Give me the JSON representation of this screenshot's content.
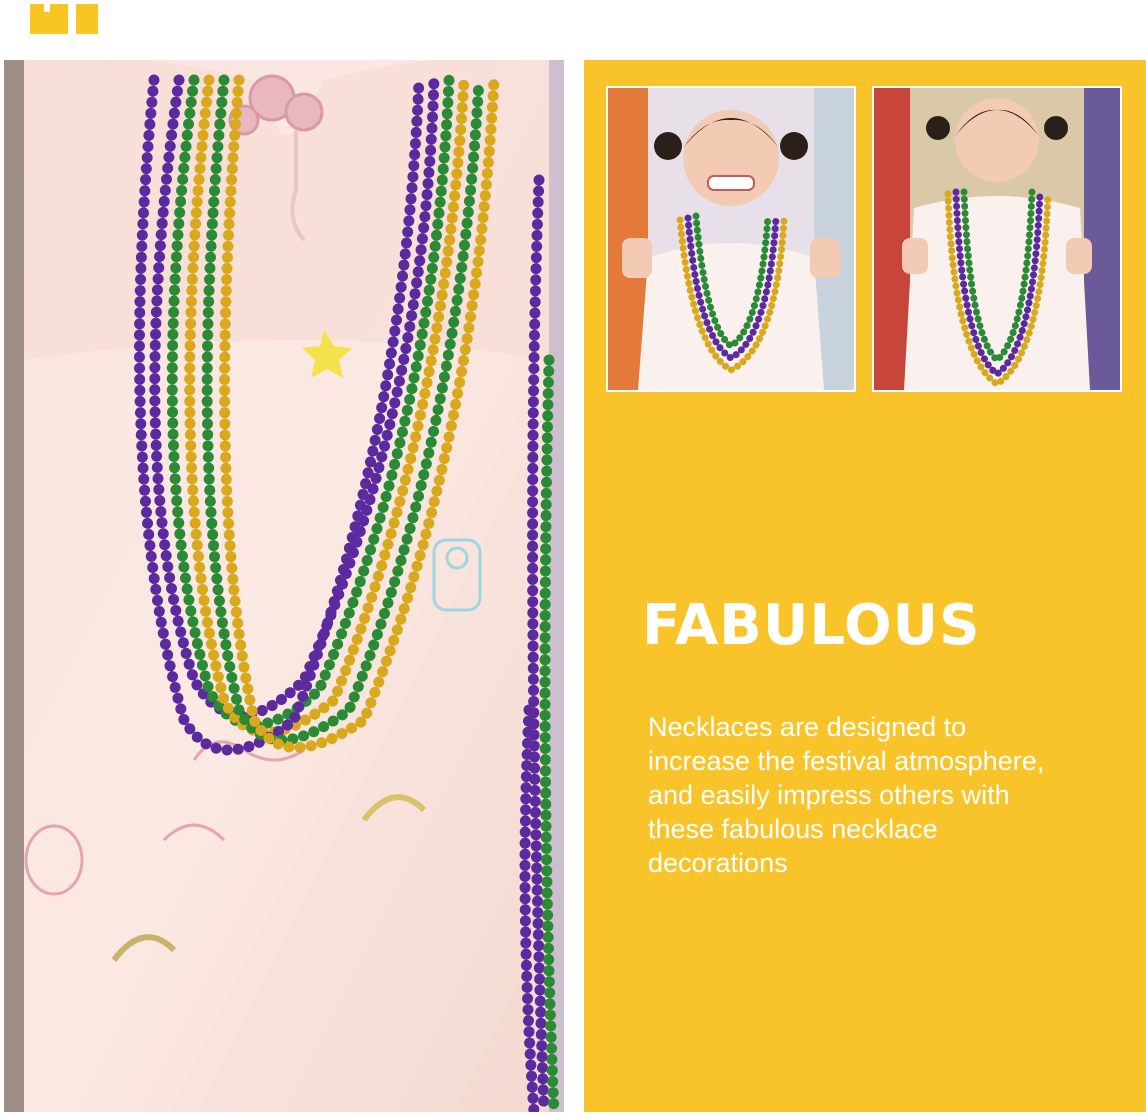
{
  "brand": {
    "accent": "#f8c42a",
    "logo_icon": "yellow-block-mark"
  },
  "photos": {
    "main": {
      "subject": "beaded-necklaces-on-dress",
      "bead_colors": [
        "#5a2a9e",
        "#2a8a36",
        "#d9a81c"
      ]
    },
    "thumb_1": {
      "subject": "girl-wearing-necklaces"
    },
    "thumb_2": {
      "subject": "girl-wearing-necklaces"
    }
  },
  "content": {
    "headline": "FABULOUS",
    "body_lines": [
      "Necklaces are designed to",
      "increase the festival atmosphere,",
      "and easily impress others with",
      "these fabulous necklace",
      "decorations"
    ]
  }
}
